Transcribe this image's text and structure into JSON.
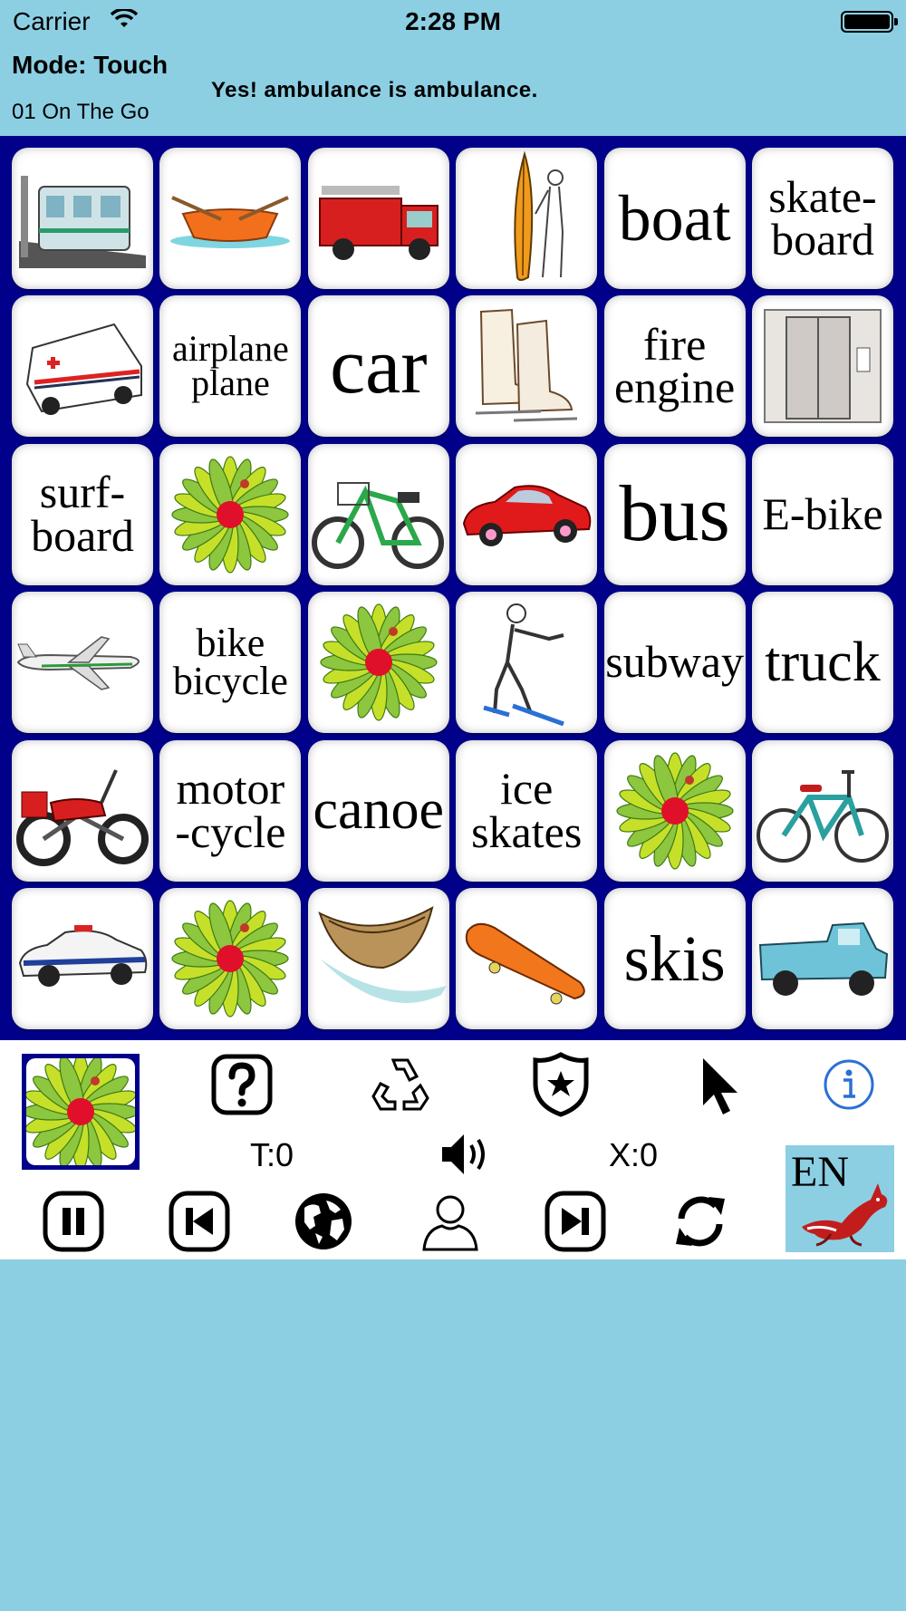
{
  "status": {
    "carrier": "Carrier",
    "time": "2:28 PM"
  },
  "header": {
    "mode_label": "Mode: Touch",
    "deck_name": "01 On The Go",
    "feedback": "Yes! ambulance is ambulance."
  },
  "board": {
    "tiles": [
      {
        "kind": "image",
        "icon": "subway-train-icon"
      },
      {
        "kind": "image",
        "icon": "rowboat-icon"
      },
      {
        "kind": "image",
        "icon": "fire-engine-icon"
      },
      {
        "kind": "image",
        "icon": "surfboard-icon"
      },
      {
        "kind": "text",
        "lines": [
          "boat"
        ]
      },
      {
        "kind": "text",
        "lines": [
          "skate-",
          "board"
        ]
      },
      {
        "kind": "image",
        "icon": "ambulance-icon"
      },
      {
        "kind": "text",
        "lines": [
          "airplane",
          "plane"
        ]
      },
      {
        "kind": "text",
        "lines": [
          "car"
        ]
      },
      {
        "kind": "image",
        "icon": "ice-skates-icon"
      },
      {
        "kind": "text",
        "lines": [
          "fire",
          "engine"
        ]
      },
      {
        "kind": "image",
        "icon": "elevator-icon"
      },
      {
        "kind": "text",
        "lines": [
          "surf-",
          "board"
        ]
      },
      {
        "kind": "image",
        "icon": "flower-icon"
      },
      {
        "kind": "image",
        "icon": "e-bike-icon"
      },
      {
        "kind": "image",
        "icon": "red-car-icon"
      },
      {
        "kind": "text",
        "lines": [
          "bus"
        ]
      },
      {
        "kind": "text",
        "lines": [
          "E-bike"
        ]
      },
      {
        "kind": "image",
        "icon": "airplane-icon"
      },
      {
        "kind": "text",
        "lines": [
          "bike",
          "bicycle"
        ]
      },
      {
        "kind": "image",
        "icon": "flower-icon"
      },
      {
        "kind": "image",
        "icon": "skier-icon"
      },
      {
        "kind": "text",
        "lines": [
          "subway"
        ]
      },
      {
        "kind": "text",
        "lines": [
          "truck"
        ]
      },
      {
        "kind": "image",
        "icon": "motorcycle-icon"
      },
      {
        "kind": "text",
        "lines": [
          "motor",
          "-cycle"
        ]
      },
      {
        "kind": "text",
        "lines": [
          "canoe"
        ]
      },
      {
        "kind": "text",
        "lines": [
          "ice",
          "skates"
        ]
      },
      {
        "kind": "image",
        "icon": "flower-icon"
      },
      {
        "kind": "image",
        "icon": "bicycle-icon"
      },
      {
        "kind": "image",
        "icon": "police-car-icon"
      },
      {
        "kind": "image",
        "icon": "flower-icon"
      },
      {
        "kind": "image",
        "icon": "canoe-icon"
      },
      {
        "kind": "image",
        "icon": "skateboard-icon"
      },
      {
        "kind": "text",
        "lines": [
          "skis"
        ]
      },
      {
        "kind": "image",
        "icon": "pickup-truck-icon"
      }
    ]
  },
  "toolbar": {
    "timer": "T:0",
    "mistakes": "X:0",
    "language": "EN",
    "top_icons": [
      "help-icon",
      "recycle-icon",
      "shield-star-icon",
      "pointer-icon",
      "info-icon"
    ],
    "bottom_icons": [
      "pause-icon",
      "previous-icon",
      "globe-icon",
      "user-icon",
      "next-icon",
      "refresh-icon"
    ]
  },
  "colors": {
    "background": "#8ccfe3",
    "board": "#00008b",
    "info_blue": "#2a6fd6"
  }
}
